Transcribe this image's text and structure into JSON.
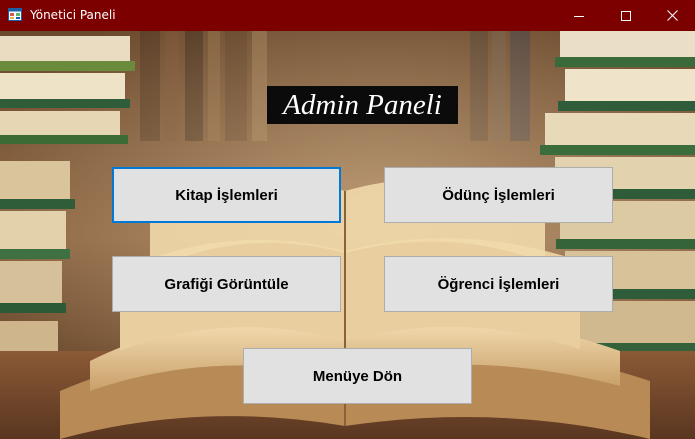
{
  "window": {
    "title": "Yönetici Paneli",
    "controls": [
      "minimize",
      "maximize",
      "close"
    ],
    "titlebar_color": "#7d0000"
  },
  "heading": "Admin Paneli",
  "buttons": {
    "kitap": "Kitap İşlemleri",
    "odunc": "Ödünç İşlemleri",
    "grafik": "Grafiği Görüntüle",
    "ogrenci": "Öğrenci İşlemleri",
    "menu": "Menüye Dön"
  },
  "focused_button": "kitap",
  "colors": {
    "button_face": "#e1e1e1",
    "focus_border": "#0078d7",
    "heading_bg": "#0b0b0b"
  }
}
